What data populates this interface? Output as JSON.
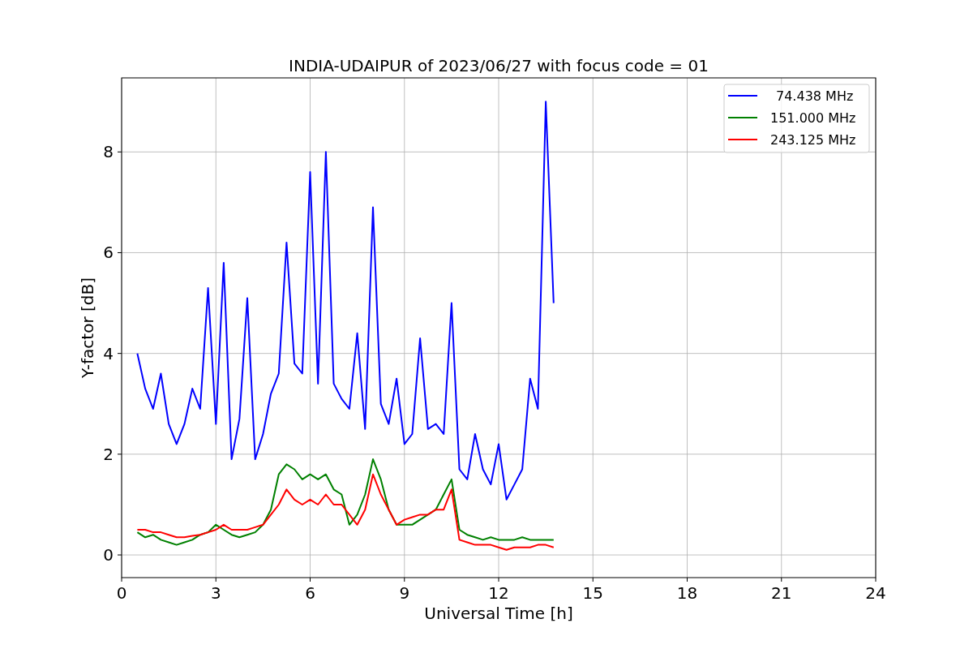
{
  "chart_data": {
    "type": "line",
    "title": "INDIA-UDAIPUR of 2023/06/27 with focus code = 01",
    "xlabel": "Universal Time [h]",
    "ylabel": "Y-factor [dB]",
    "x": [
      0.5,
      0.75,
      1,
      1.25,
      1.5,
      1.75,
      2,
      2.25,
      2.5,
      2.75,
      3,
      3.25,
      3.5,
      3.75,
      4,
      4.25,
      4.5,
      4.75,
      5,
      5.25,
      5.5,
      5.75,
      6,
      6.25,
      6.5,
      6.75,
      7,
      7.25,
      7.5,
      7.75,
      8,
      8.25,
      8.5,
      8.75,
      9,
      9.25,
      9.5,
      9.75,
      10,
      10.25,
      10.5,
      10.75,
      11,
      11.25,
      11.5,
      11.75,
      12,
      12.25,
      12.5,
      12.75,
      13,
      13.25,
      13.5,
      13.75
    ],
    "series": [
      {
        "name": "74.438 MHz",
        "color": "#0000ff",
        "values": [
          4.0,
          3.3,
          2.9,
          3.6,
          2.6,
          2.2,
          2.6,
          3.3,
          2.9,
          5.3,
          2.6,
          5.8,
          1.9,
          2.7,
          5.1,
          1.9,
          2.4,
          3.2,
          3.6,
          6.2,
          3.8,
          3.6,
          7.6,
          3.4,
          8.0,
          3.4,
          3.1,
          2.9,
          4.4,
          2.5,
          6.9,
          3.0,
          2.6,
          3.5,
          2.2,
          2.4,
          4.3,
          2.5,
          2.6,
          2.4,
          5.0,
          1.7,
          1.5,
          2.4,
          1.7,
          1.4,
          2.2,
          1.1,
          1.4,
          1.7,
          3.5,
          2.9,
          9.0,
          5.0
        ]
      },
      {
        "name": "151.000 MHz",
        "color": "#008000",
        "values": [
          0.45,
          0.35,
          0.4,
          0.3,
          0.25,
          0.2,
          0.25,
          0.3,
          0.4,
          0.45,
          0.6,
          0.5,
          0.4,
          0.35,
          0.4,
          0.45,
          0.6,
          0.9,
          1.6,
          1.8,
          1.7,
          1.5,
          1.6,
          1.5,
          1.6,
          1.3,
          1.2,
          0.6,
          0.8,
          1.2,
          1.9,
          1.5,
          0.9,
          0.6,
          0.6,
          0.6,
          0.7,
          0.8,
          0.9,
          1.2,
          1.5,
          0.5,
          0.4,
          0.35,
          0.3,
          0.35,
          0.3,
          0.3,
          0.3,
          0.35,
          0.3,
          0.3,
          0.3,
          0.3
        ]
      },
      {
        "name": "243.125 MHz",
        "color": "#ff0000",
        "values": [
          0.5,
          0.5,
          0.45,
          0.45,
          0.4,
          0.35,
          0.35,
          0.38,
          0.4,
          0.45,
          0.5,
          0.6,
          0.5,
          0.5,
          0.5,
          0.55,
          0.6,
          0.8,
          1.0,
          1.3,
          1.1,
          1.0,
          1.1,
          1.0,
          1.2,
          1.0,
          1.0,
          0.8,
          0.6,
          0.9,
          1.6,
          1.2,
          0.9,
          0.6,
          0.7,
          0.75,
          0.8,
          0.8,
          0.9,
          0.9,
          1.3,
          0.3,
          0.25,
          0.2,
          0.2,
          0.2,
          0.15,
          0.1,
          0.15,
          0.15,
          0.15,
          0.2,
          0.2,
          0.15
        ]
      }
    ],
    "xlim": [
      0,
      24
    ],
    "ylim": [
      -0.45,
      9.47
    ],
    "xticks": [
      0,
      3,
      6,
      9,
      12,
      15,
      18,
      21,
      24
    ],
    "yticks": [
      0,
      2,
      4,
      6,
      8
    ],
    "grid": true,
    "legend": true
  }
}
